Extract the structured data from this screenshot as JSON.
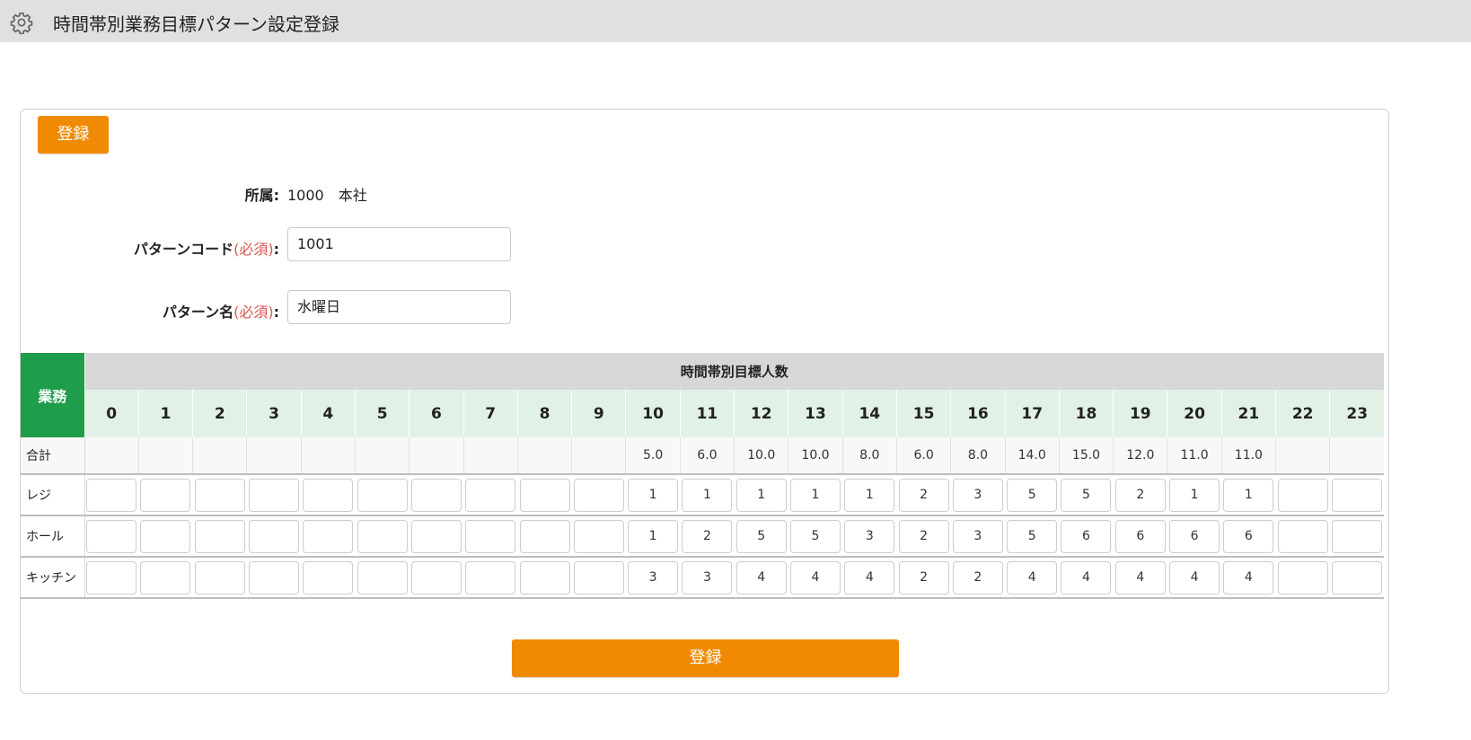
{
  "header": {
    "icon": "gear-icon",
    "title": "時間帯別業務目標パターン設定登録"
  },
  "form": {
    "register_label": "登録",
    "affiliation": {
      "label": "所属:",
      "value": "1000　本社"
    },
    "pattern_code": {
      "label": "パターンコード",
      "required": "(必須)",
      "colon": ":",
      "value": "1001"
    },
    "pattern_name": {
      "label": "パターン名",
      "required": "(必須)",
      "colon": ":",
      "value": "水曜日"
    }
  },
  "table": {
    "business_header": "業務",
    "group_header": "時間帯別目標人数",
    "hours": [
      "0",
      "1",
      "2",
      "3",
      "4",
      "5",
      "6",
      "7",
      "8",
      "9",
      "10",
      "11",
      "12",
      "13",
      "14",
      "15",
      "16",
      "17",
      "18",
      "19",
      "20",
      "21",
      "22",
      "23"
    ],
    "total_label": "合計",
    "totals": [
      "",
      "",
      "",
      "",
      "",
      "",
      "",
      "",
      "",
      "",
      "5.0",
      "6.0",
      "10.0",
      "10.0",
      "8.0",
      "6.0",
      "8.0",
      "14.0",
      "15.0",
      "12.0",
      "11.0",
      "11.0",
      "",
      ""
    ],
    "rows": [
      {
        "label": "レジ",
        "values": [
          "",
          "",
          "",
          "",
          "",
          "",
          "",
          "",
          "",
          "",
          "1",
          "1",
          "1",
          "1",
          "1",
          "2",
          "3",
          "5",
          "5",
          "2",
          "1",
          "1",
          "",
          ""
        ]
      },
      {
        "label": "ホール",
        "values": [
          "",
          "",
          "",
          "",
          "",
          "",
          "",
          "",
          "",
          "",
          "1",
          "2",
          "5",
          "5",
          "3",
          "2",
          "3",
          "5",
          "6",
          "6",
          "6",
          "6",
          "",
          ""
        ]
      },
      {
        "label": "キッチン",
        "values": [
          "",
          "",
          "",
          "",
          "",
          "",
          "",
          "",
          "",
          "",
          "3",
          "3",
          "4",
          "4",
          "4",
          "2",
          "2",
          "4",
          "4",
          "4",
          "4",
          "4",
          "",
          ""
        ]
      }
    ]
  },
  "colors": {
    "accent": "#f08a00",
    "business_header": "#1e9e4a",
    "hour_header": "#e2f1e6",
    "required": "#d9534f"
  }
}
